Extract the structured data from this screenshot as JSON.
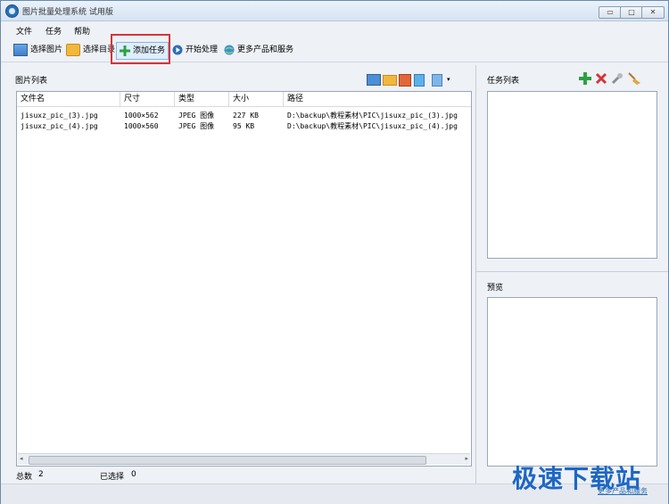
{
  "window": {
    "title": "图片批量处理系统 试用版"
  },
  "window_buttons": {
    "minimize": "▭",
    "maximize": "□",
    "close": "✕"
  },
  "menu": [
    "文件",
    "任务",
    "帮助"
  ],
  "toolbar": {
    "select_image": "选择图片",
    "select_dir": "选择目录",
    "add_task": "添加任务",
    "start": "开始处理",
    "more": "更多产品和服务"
  },
  "image_list": {
    "title": "图片列表",
    "columns": [
      "文件名",
      "尺寸",
      "类型",
      "大小",
      "路径"
    ],
    "rows": [
      [
        "jisuxz_pic_(3).jpg",
        "1000×562",
        "JPEG 图像",
        "227 KB",
        "D:\\backup\\教程素材\\PIC\\jisuxz_pic_(3).jpg"
      ],
      [
        "jisuxz_pic_(4).jpg",
        "1000×560",
        "JPEG 图像",
        "95 KB",
        "D:\\backup\\教程素材\\PIC\\jisuxz_pic_(4).jpg"
      ]
    ]
  },
  "task_list": {
    "title": "任务列表"
  },
  "preview": {
    "title": "预览"
  },
  "status": {
    "total_label": "总数",
    "total_value": "2",
    "selected_label": "已选择",
    "selected_value": "0"
  },
  "footer": {
    "watermark": "极速下载站",
    "link": "更多产品和服务"
  },
  "colors": {
    "highlight": "#d6343a",
    "accent": "#2c6fb5"
  }
}
